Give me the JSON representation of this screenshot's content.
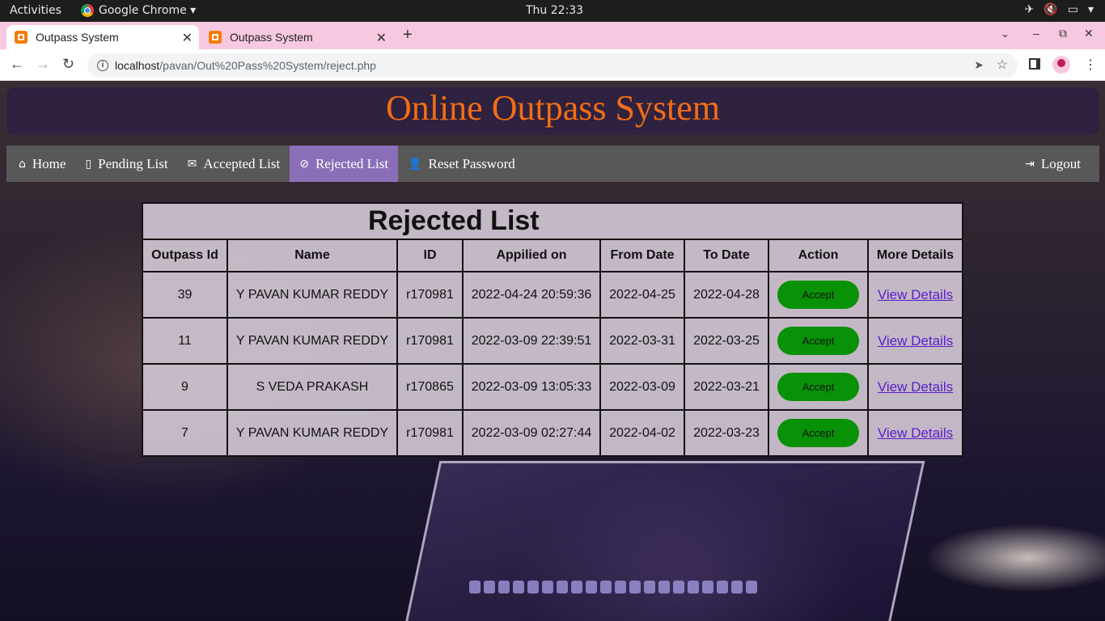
{
  "system_bar": {
    "activities": "Activities",
    "app_name": "Google Chrome ▾",
    "clock": "Thu 22:33"
  },
  "browser": {
    "tabs": [
      {
        "title": "Outpass System",
        "active": true
      },
      {
        "title": "Outpass System",
        "active": false
      }
    ],
    "url_host": "localhost",
    "url_path": "/pavan/Out%20Pass%20System/reject.php"
  },
  "site": {
    "title": "Online Outpass System",
    "nav": [
      {
        "label": "Home",
        "icon": "home-icon",
        "active": false
      },
      {
        "label": "Pending List",
        "icon": "book-icon",
        "active": false
      },
      {
        "label": "Accepted List",
        "icon": "envelope-icon",
        "active": false
      },
      {
        "label": "Rejected List",
        "icon": "ban-icon",
        "active": true
      },
      {
        "label": "Reset Password",
        "icon": "user-icon",
        "active": false
      }
    ],
    "logout": "Logout"
  },
  "table": {
    "title": "Rejected List",
    "headers": [
      "Outpass Id",
      "Name",
      "ID",
      "Appilied on",
      "From Date",
      "To Date",
      "Action",
      "More Details"
    ],
    "rows": [
      {
        "outpass_id": "39",
        "name": "Y PAVAN KUMAR REDDY",
        "id": "r170981",
        "applied_on": "2022-04-24 20:59:36",
        "from": "2022-04-25",
        "to": "2022-04-28",
        "action": "Accept",
        "details": "View Details"
      },
      {
        "outpass_id": "11",
        "name": "Y PAVAN KUMAR REDDY",
        "id": "r170981",
        "applied_on": "2022-03-09 22:39:51",
        "from": "2022-03-31",
        "to": "2022-03-25",
        "action": "Accept",
        "details": "View Details"
      },
      {
        "outpass_id": "9",
        "name": "S VEDA PRAKASH",
        "id": "r170865",
        "applied_on": "2022-03-09 13:05:33",
        "from": "2022-03-09",
        "to": "2022-03-21",
        "action": "Accept",
        "details": "View Details"
      },
      {
        "outpass_id": "7",
        "name": "Y PAVAN KUMAR REDDY",
        "id": "r170981",
        "applied_on": "2022-03-09 02:27:44",
        "from": "2022-04-02",
        "to": "2022-03-23",
        "action": "Accept",
        "details": "View Details"
      }
    ]
  },
  "colors": {
    "accent_title": "#f26d14",
    "nav_active": "#8a6fb8",
    "accept_button": "#099107",
    "link": "#5a1fc9"
  }
}
